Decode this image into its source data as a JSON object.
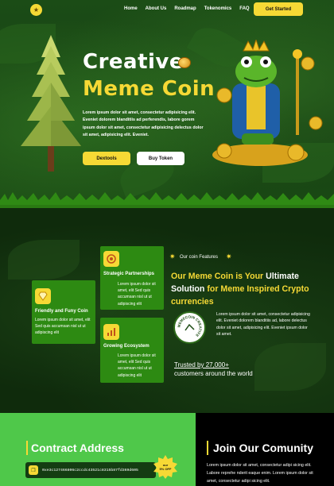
{
  "nav": {
    "logo_glyph": "★",
    "links": [
      "Home",
      "About Us",
      "Roadmap",
      "Tokenomics",
      "FAQ"
    ],
    "cta_label": "Get Started"
  },
  "hero": {
    "title_line1": "Creative",
    "title_line2": "Meme Coin",
    "description": "Lorem ipsum dolor sit amet, consectetur adipisicing elit. Eveniet dolorem blanditiis ad perferendis, labore gorem ipsum dolor sit amet, consectetur adipisicing delectus dolor sit amet, adipisicing elit. Eveniet.",
    "buttons": {
      "dextools": "Dextools",
      "buy": "Buy Token"
    }
  },
  "features": {
    "tag": "Our coin Features",
    "heading_part1": "Our Meme Coin is Your ",
    "heading_part2": "Ultimate Solution",
    "heading_part3": " for Meme Inspired Crypto currencies",
    "badge_text": "MEMECOIN CREATIVE",
    "description": "Lorem ipsum dolor sit amet, consectetur adipisicing elit. Eveniet dolorem blanditiis ad, labore delectus dolor sit amet, adipisicing elit. Eveniet ipsum dolor sit amet.",
    "trusted_line1": "Trusted by 27,000+",
    "trusted_line2": "customers around the world",
    "cards": [
      {
        "title": "Strategic Partnerships",
        "text": "Lorem ipsum dolor sit amet, elit Sed quis accumsan nisl ut ut adipiscing elit",
        "icon": "target-icon"
      },
      {
        "title": "Friendly and Funy Coin",
        "text": "Lorem ipsum dolor sit amet, elit Sed quis accumsan nisl ut ut adipiscing elit",
        "icon": "diamond-icon"
      },
      {
        "title": "Growing Ecosystem",
        "text": "Lorem ipsum dolor sit amet, elit Sed quis accumsan nisl ut ut adipiscing elit",
        "icon": "growth-icon"
      }
    ]
  },
  "contract": {
    "title": "Contract Address",
    "address": "0xe3c127466806c2ccdc43521c8315b87fd369d605",
    "sticker_text": "our 5% OFF"
  },
  "community": {
    "title": "Join Our Comunity",
    "text": "Lorem ipsum dolor sit amet, consectetur adipi sicing elit. Labore reprehe nderit eaque enim. Lorem ipsum dolor sit amet, consectetur adipi sicing elit."
  },
  "colors": {
    "accent": "#f6d935",
    "green": "#2d8a12",
    "bright_green": "#4fc84a",
    "dark": "#0f2b0c"
  }
}
